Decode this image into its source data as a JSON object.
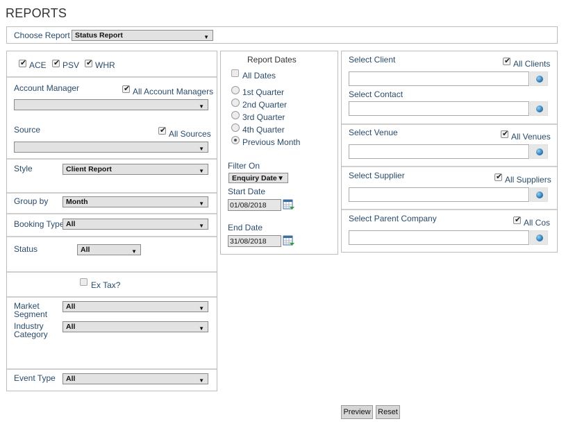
{
  "page": {
    "title": "REPORTS"
  },
  "choose_report": {
    "label": "Choose Report",
    "value": "Status Report"
  },
  "left": {
    "brands": [
      {
        "label": "ACE",
        "checked": true
      },
      {
        "label": "PSV",
        "checked": true
      },
      {
        "label": "WHR",
        "checked": true
      }
    ],
    "account_manager": {
      "label": "Account Manager",
      "all_label": "All Account Managers",
      "checked": true,
      "value": ""
    },
    "source": {
      "label": "Source",
      "all_label": "All Sources",
      "checked": true,
      "value": ""
    },
    "style": {
      "label": "Style",
      "value": "Client Report"
    },
    "group_by": {
      "label": "Group by",
      "value": "Month"
    },
    "booking_type": {
      "label": "Booking Type",
      "value": "All"
    },
    "status": {
      "label": "Status",
      "value": "All"
    },
    "ex_tax": {
      "label": "Ex Tax?",
      "checked": false
    },
    "market_segment": {
      "label_line1": "Market",
      "label_line2": "Segment",
      "value": "All"
    },
    "industry_category": {
      "label_line1": "Industry",
      "label_line2": "Category",
      "value": "All"
    },
    "event_type": {
      "label": "Event Type",
      "value": "All"
    }
  },
  "middle": {
    "heading": "Report Dates",
    "all_dates": {
      "label": "All Dates",
      "checked": false
    },
    "periods": [
      {
        "label": "1st Quarter",
        "selected": false
      },
      {
        "label": "2nd Quarter",
        "selected": false
      },
      {
        "label": "3rd Quarter",
        "selected": false
      },
      {
        "label": "4th Quarter",
        "selected": false
      },
      {
        "label": "Previous Month",
        "selected": true
      }
    ],
    "filter_on": {
      "label": "Filter On",
      "value": "Enquiry Date"
    },
    "start_date": {
      "label": "Start Date",
      "value": "01/08/2018"
    },
    "end_date": {
      "label": "End Date",
      "value": "31/08/2018"
    }
  },
  "right": {
    "client": {
      "label": "Select Client",
      "all_label": "All Clients",
      "checked": true
    },
    "contact": {
      "label": "Select Contact"
    },
    "venue": {
      "label": "Select Venue",
      "all_label": "All Venues",
      "checked": true
    },
    "supplier": {
      "label": "Select Supplier",
      "all_label": "All Suppliers",
      "checked": true
    },
    "parent_company": {
      "label": "Select Parent Company",
      "all_label": "All Cos",
      "checked": true
    }
  },
  "actions": {
    "preview": "Preview",
    "reset": "Reset"
  }
}
